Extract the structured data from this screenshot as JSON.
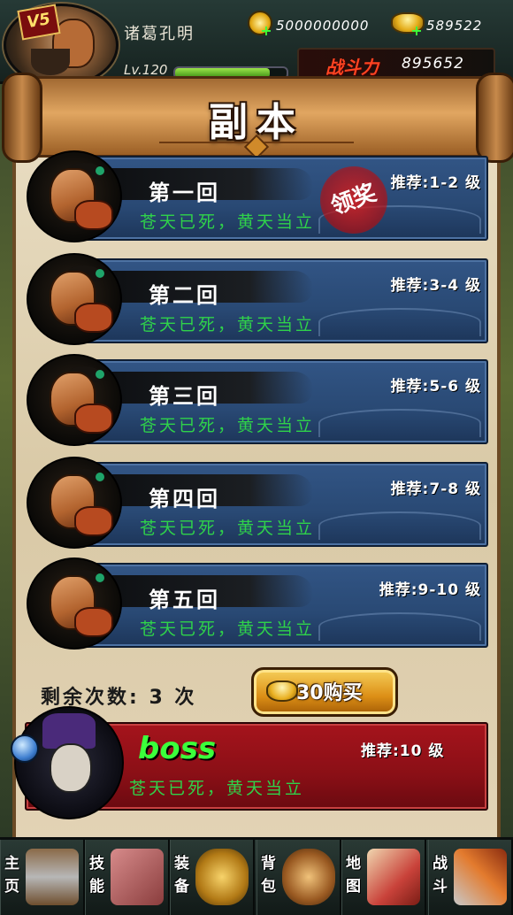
{
  "player": {
    "vip": "V5",
    "name": "诸葛孔明",
    "level": "Lv.120",
    "hp_fraction": 0.85
  },
  "resources": {
    "coins": "5000000000",
    "gold": "589522",
    "power_label": "战斗力",
    "power_value": "895652"
  },
  "page_title": "副本",
  "stages": [
    {
      "name": "第一回",
      "recommend": "推荐:1-2 级",
      "desc": "苍天已死，黄天当立",
      "seal": "领奖"
    },
    {
      "name": "第二回",
      "recommend": "推荐:3-4 级",
      "desc": "苍天已死，黄天当立"
    },
    {
      "name": "第三回",
      "recommend": "推荐:5-6 级",
      "desc": "苍天已死，黄天当立"
    },
    {
      "name": "第四回",
      "recommend": "推荐:7-8 级",
      "desc": "苍天已死，黄天当立"
    },
    {
      "name": "第五回",
      "recommend": "推荐:9-10 级",
      "desc": "苍天已死，黄天当立"
    }
  ],
  "remaining": {
    "text": "剩余次数: 3 次",
    "buy_label": "30购买"
  },
  "boss": {
    "name": "boss",
    "recommend": "推荐:10 级",
    "desc": "苍天已死，黄天当立"
  },
  "nav": [
    {
      "label": "主页",
      "icon": "home-icon"
    },
    {
      "label": "技能",
      "icon": "skill-scroll-icon"
    },
    {
      "label": "装备",
      "icon": "armor-icon"
    },
    {
      "label": "背包",
      "icon": "bag-icon"
    },
    {
      "label": "地图",
      "icon": "map-icon"
    },
    {
      "label": "战斗",
      "icon": "crossed-swords-icon"
    }
  ],
  "colors": {
    "stage_card": "#294974",
    "boss_card": "#8a0f16",
    "desc_green": "#2fd24a",
    "power_red": "#ff4422"
  }
}
